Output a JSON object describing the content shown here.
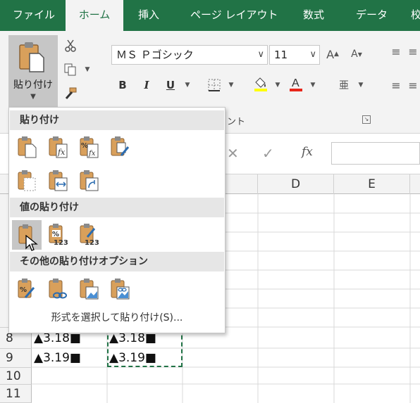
{
  "ribbon": {
    "tabs": [
      "ファイル",
      "ホーム",
      "挿入",
      "ページ レイアウト",
      "数式",
      "データ",
      "校"
    ],
    "active_tab": "ホーム",
    "paste_label": "貼り付け",
    "font_name": "ＭＳ Ｐゴシック",
    "font_size": "11",
    "bold_label": "B",
    "italic_label": "I",
    "underline_label": "U",
    "font_group_label": "ント",
    "accent_color": "#217346",
    "font_color_bar": "#e8261a",
    "fill_color_bar": "#ffff00"
  },
  "formula_bar": {
    "cancel_symbol": "✕",
    "enter_symbol": "✓",
    "fx_label": "fx"
  },
  "grid": {
    "columns": [
      "D",
      "E"
    ],
    "rows": [
      "8",
      "9",
      "10",
      "11"
    ],
    "cells": [
      {
        "row": "8",
        "a": "▲3.18■",
        "b": "▲3.18■"
      },
      {
        "row": "9",
        "a": "▲3.19■",
        "b": "▲3.19■"
      }
    ]
  },
  "paste_menu": {
    "section_paste": "貼り付け",
    "section_values": "値の貼り付け",
    "section_other": "その他の貼り付けオプション",
    "special_link": "形式を選択して貼り付け(S)...",
    "icons_row1": [
      "paste-icon",
      "paste-formulas-icon",
      "paste-formulas-number-format-icon",
      "paste-keep-source-format-icon"
    ],
    "icons_row2": [
      "paste-no-borders-icon",
      "paste-keep-column-width-icon",
      "paste-transpose-icon"
    ],
    "icons_values": [
      "paste-values-icon",
      "paste-values-number-format-icon",
      "paste-values-source-format-icon"
    ],
    "icons_other": [
      "paste-formatting-icon",
      "paste-link-icon",
      "paste-picture-icon",
      "paste-linked-picture-icon"
    ],
    "badge_123": "123",
    "badge_percent": "%"
  }
}
